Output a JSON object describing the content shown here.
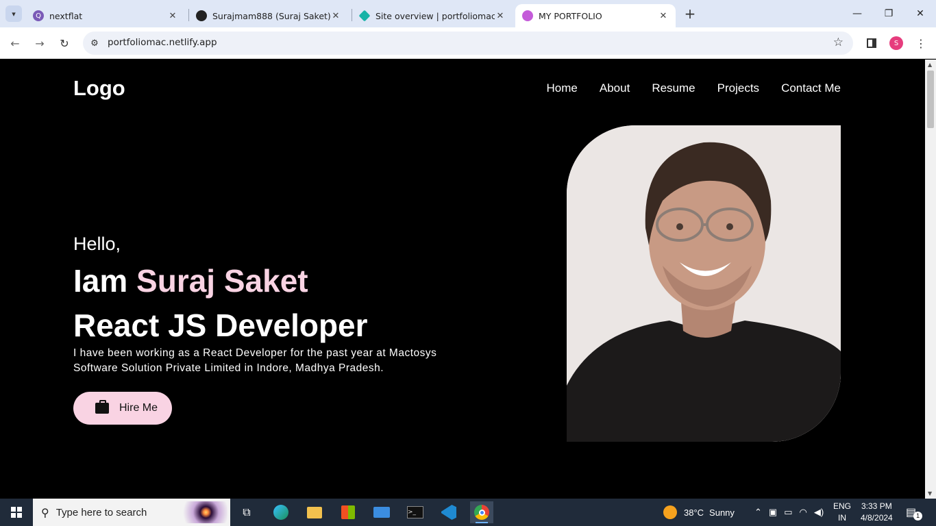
{
  "browser": {
    "tabs": [
      {
        "title": "nextflat",
        "favicon": "Q",
        "favicon_color": "#7a5ab7"
      },
      {
        "title": "Surajmam888 (Suraj Saket)",
        "favicon": "github-icon",
        "favicon_color": "#222222"
      },
      {
        "title": "Site overview | portfoliomac | N",
        "favicon": "netlify-icon",
        "favicon_color": "#17b3a7"
      },
      {
        "title": "MY PORTFOLIO",
        "favicon": "portfolio-icon",
        "favicon_color": "#c45bd9"
      }
    ],
    "url": "portfoliomac.netlify.app",
    "profile_initial": "S"
  },
  "site": {
    "logo": "Logo",
    "nav": [
      "Home",
      "About",
      "Resume",
      "Projects",
      "Contact Me"
    ],
    "hello": "Hello,",
    "iam": "Iam",
    "name": "Suraj Saket",
    "role": "React JS Developer",
    "description": "I have been working as a React Developer for the past year at Mactosys Software Solution Private Limited in Indore, Madhya Pradesh.",
    "hire_label": "Hire Me",
    "accent_color": "#f9d3e3"
  },
  "taskbar": {
    "search_placeholder": "Type here to search",
    "weather_temp": "38°C",
    "weather_desc": "Sunny",
    "lang": "ENG",
    "region": "IN",
    "time": "3:33 PM",
    "date": "4/8/2024",
    "notification_count": "1"
  }
}
